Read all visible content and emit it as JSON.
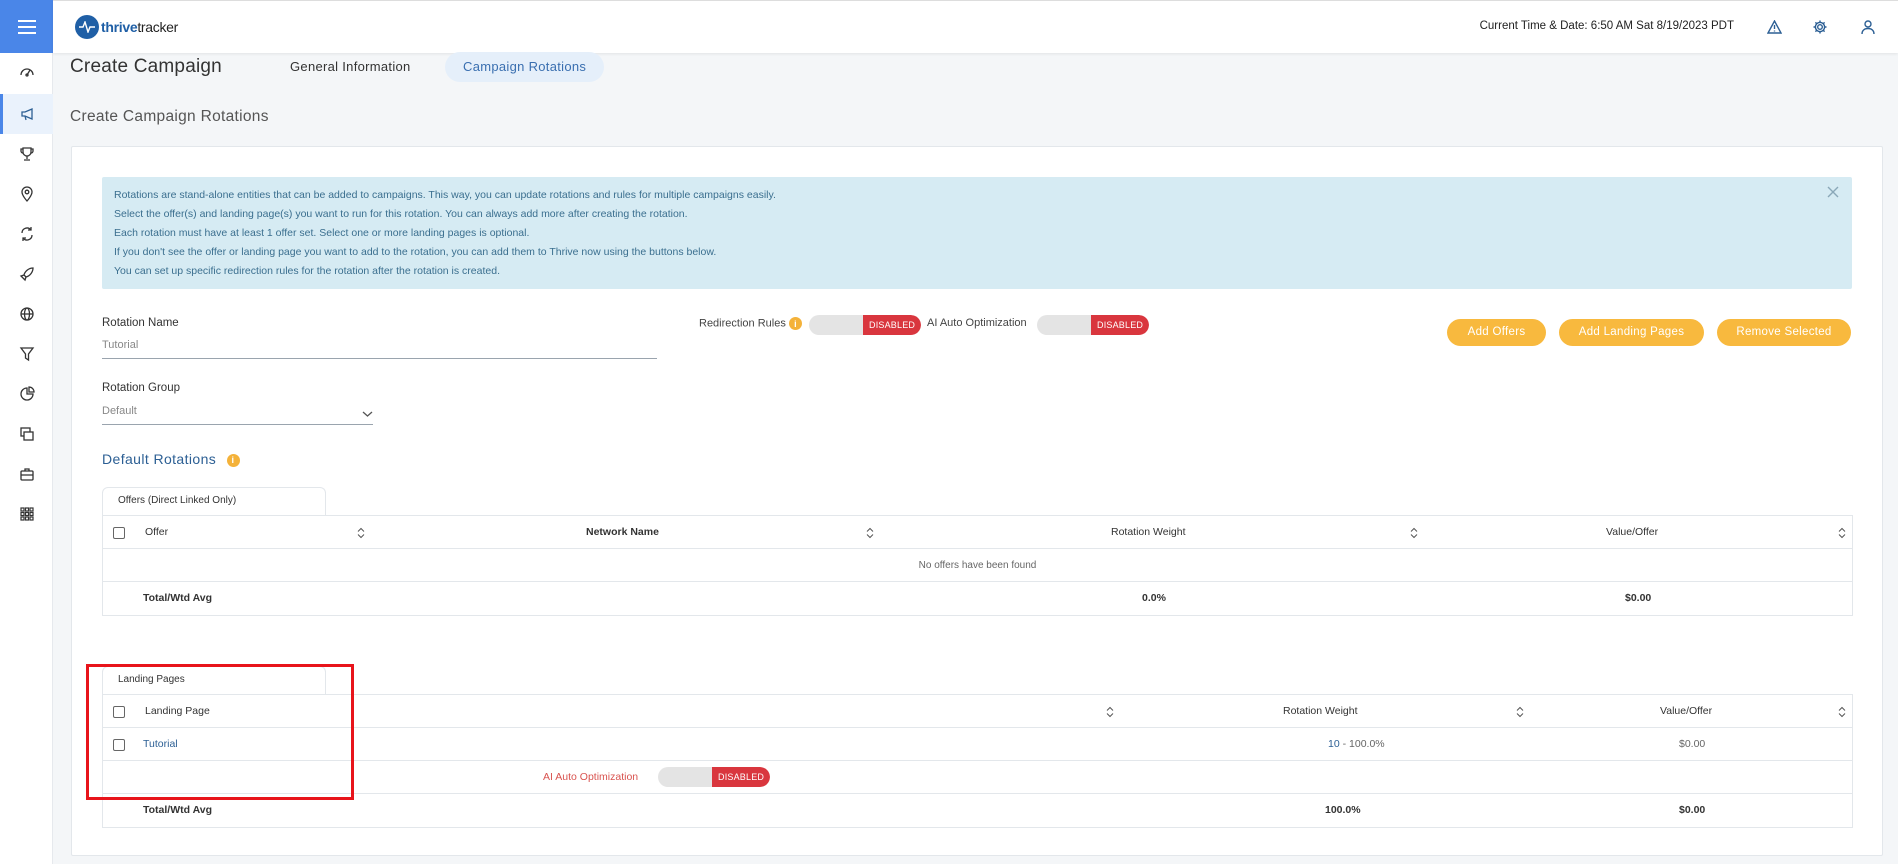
{
  "topbar": {
    "logo_text_bold": "thrive",
    "logo_text_rest": "tracker",
    "datetime": "Current Time & Date: 6:50 AM Sat 8/19/2023 PDT"
  },
  "header": {
    "title": "Create Campaign",
    "tabs": [
      {
        "label": "General Information"
      },
      {
        "label": "Campaign Rotations"
      }
    ],
    "section_title": "Create Campaign Rotations"
  },
  "info": {
    "lines": [
      "Rotations are stand-alone entities that can be added to campaigns. This way, you can update rotations and rules for multiple campaigns easily.",
      "Select the offer(s) and landing page(s) you want to run for this rotation. You can always add more after creating the rotation.",
      "Each rotation must have at least 1 offer set. Select one or more landing pages is optional.",
      "If you don't see the offer or landing page you want to add to the rotation, you can add them to Thrive now using the buttons below.",
      "You can set up specific redirection rules for the rotation after the rotation is created."
    ]
  },
  "form": {
    "rotation_name_label": "Rotation Name",
    "rotation_name_value": "Tutorial",
    "rotation_group_label": "Rotation Group",
    "rotation_group_value": "Default",
    "redirection_rules_label": "Redirection Rules",
    "ai_auto_label": "AI Auto Optimization",
    "disabled_label": "DISABLED"
  },
  "buttons": {
    "add_offers": "Add Offers",
    "add_landing_pages": "Add Landing Pages",
    "remove_selected": "Remove Selected"
  },
  "default_rotations": {
    "heading": "Default Rotations",
    "offers_tab": "Offers (Direct Linked Only)",
    "offers_columns": [
      "Offer",
      "Network Name",
      "Rotation Weight",
      "Value/Offer"
    ],
    "offers_empty": "No offers have been found",
    "offers_total_label": "Total/Wtd Avg",
    "offers_total_weight": "0.0%",
    "offers_total_value": "$0.00",
    "lp_tab": "Landing Pages",
    "lp_columns": [
      "Landing Page",
      "Rotation Weight",
      "Value/Offer"
    ],
    "lp_rows": [
      {
        "name": "Tutorial",
        "weight_num": "10",
        "weight_pct": " - 100.0%",
        "value": "$0.00"
      }
    ],
    "lp_ai_label": "AI Auto Optimization",
    "lp_total_label": "Total/Wtd Avg",
    "lp_total_weight": "100.0%",
    "lp_total_value": "$0.00"
  }
}
